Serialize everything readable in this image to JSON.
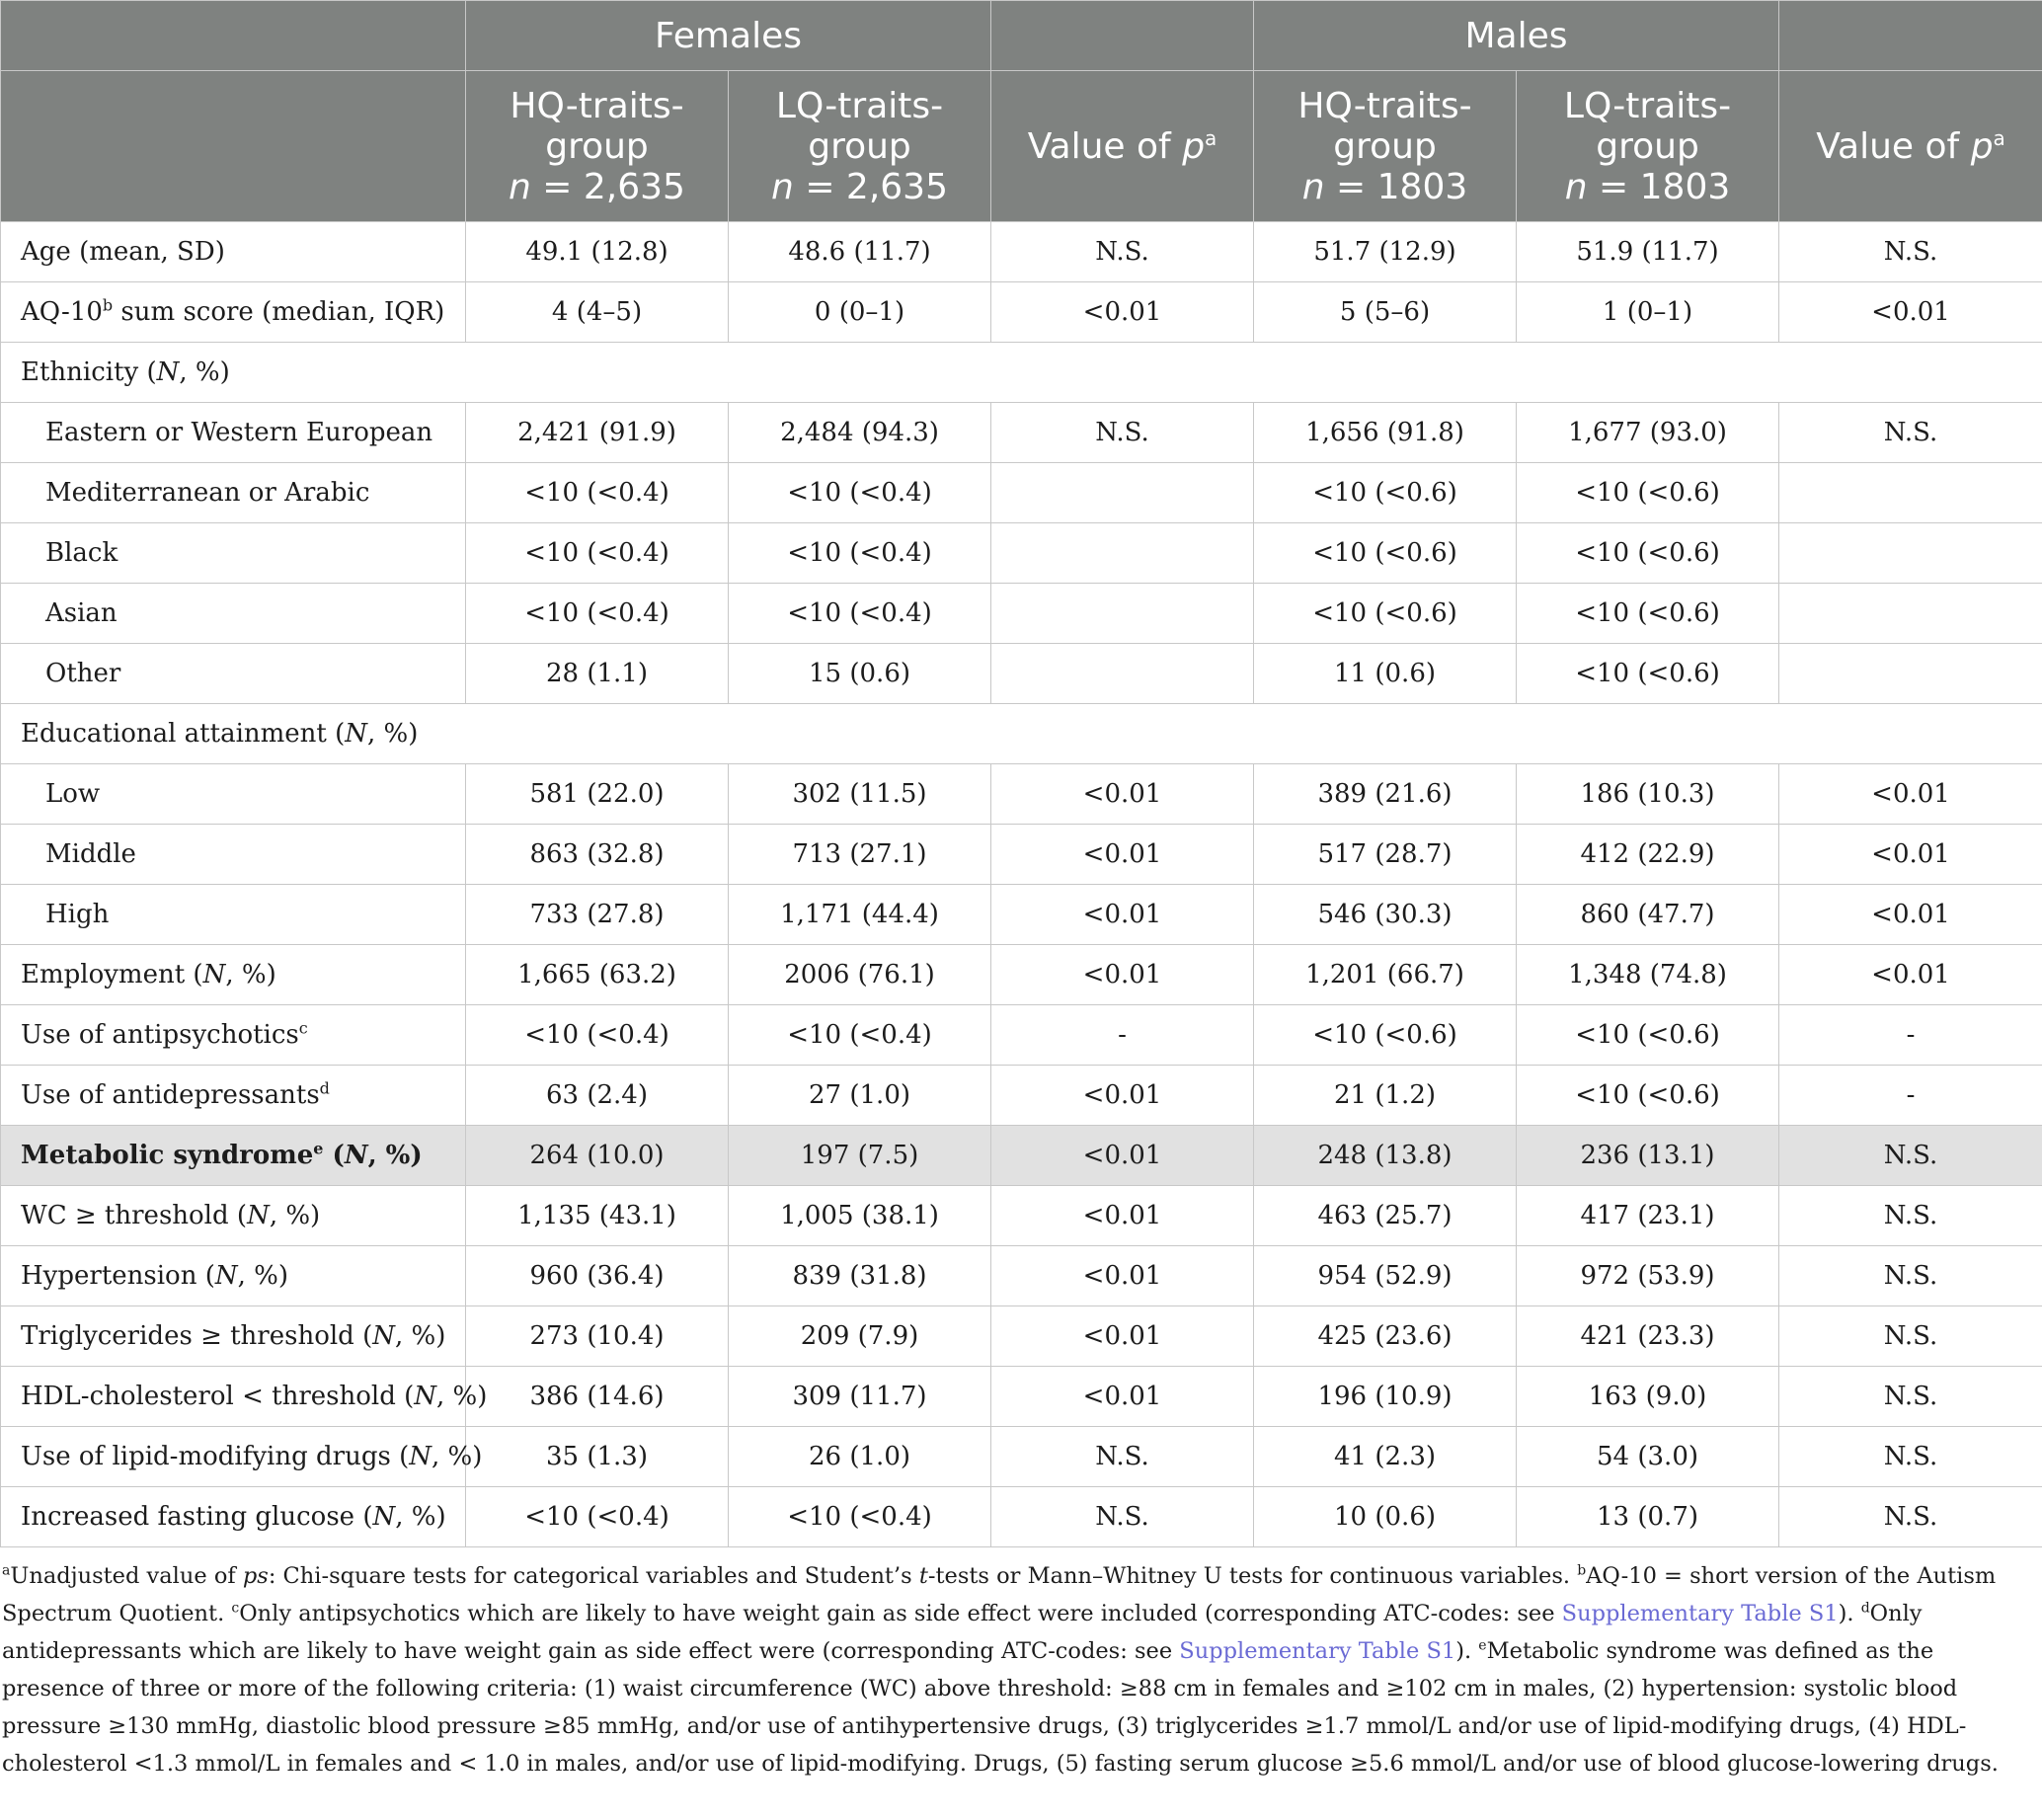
{
  "header": {
    "group_females": "Females",
    "group_males": "Males",
    "col_hq_title": "HQ-traits-group",
    "col_lq_title": "LQ-traits-group",
    "n_prefix": "n",
    "females_n": "= 2,635",
    "males_n": "= 1803",
    "pvalue_label": "Value of",
    "pvalue_symbol": "p",
    "pvalue_sup": "a"
  },
  "rows": [
    {
      "label": "Age (mean, SD)",
      "fhq": "49.1 (12.8)",
      "flq": "48.6 (11.7)",
      "fp": "N.S.",
      "mhq": "51.7 (12.9)",
      "mlq": "51.9 (11.7)",
      "mp": "N.S."
    },
    {
      "label_pre": "AQ-10",
      "sup": "b",
      "label_post": " sum score (median, IQR)",
      "fhq": "4 (4–5)",
      "flq": "0 (0–1)",
      "fp": "<0.01",
      "mhq": "5 (5–6)",
      "mlq": "1 (0–1)",
      "mp": "<0.01"
    },
    {
      "label_pre": "Ethnicity (",
      "label_it": "N",
      "label_post": ", %)"
    },
    {
      "label": "Eastern or Western European",
      "fhq": "2,421 (91.9)",
      "flq": "2,484 (94.3)",
      "fp": "N.S.",
      "mhq": "1,656 (91.8)",
      "mlq": "1,677 (93.0)",
      "mp": "N.S."
    },
    {
      "label": "Mediterranean or Arabic",
      "fhq": "<10 (<0.4)",
      "flq": "<10 (<0.4)",
      "fp": "",
      "mhq": "<10 (<0.6)",
      "mlq": "<10 (<0.6)",
      "mp": ""
    },
    {
      "label": "Black",
      "fhq": "<10 (<0.4)",
      "flq": "<10 (<0.4)",
      "fp": "",
      "mhq": "<10 (<0.6)",
      "mlq": "<10 (<0.6)",
      "mp": ""
    },
    {
      "label": "Asian",
      "fhq": "<10 (<0.4)",
      "flq": "<10 (<0.4)",
      "fp": "",
      "mhq": "<10 (<0.6)",
      "mlq": "<10 (<0.6)",
      "mp": ""
    },
    {
      "label": "Other",
      "fhq": "28 (1.1)",
      "flq": "15 (0.6)",
      "fp": "",
      "mhq": "11 (0.6)",
      "mlq": "<10 (<0.6)",
      "mp": ""
    },
    {
      "label_pre": "Educational attainment (",
      "label_it": "N",
      "label_post": ", %)"
    },
    {
      "label": "Low",
      "fhq": "581 (22.0)",
      "flq": "302 (11.5)",
      "fp": "<0.01",
      "mhq": "389 (21.6)",
      "mlq": "186 (10.3)",
      "mp": "<0.01"
    },
    {
      "label": "Middle",
      "fhq": "863 (32.8)",
      "flq": "713 (27.1)",
      "fp": "<0.01",
      "mhq": "517 (28.7)",
      "mlq": "412 (22.9)",
      "mp": "<0.01"
    },
    {
      "label": "High",
      "fhq": "733 (27.8)",
      "flq": "1,171 (44.4)",
      "fp": "<0.01",
      "mhq": "546 (30.3)",
      "mlq": "860 (47.7)",
      "mp": "<0.01"
    },
    {
      "label_pre": "Employment (",
      "label_it": "N",
      "label_post": ", %)",
      "fhq": "1,665 (63.2)",
      "flq": "2006 (76.1)",
      "fp": "<0.01",
      "mhq": "1,201 (66.7)",
      "mlq": "1,348 (74.8)",
      "mp": "<0.01"
    },
    {
      "label_pre": "Use of antipsychotics",
      "sup": "c",
      "fhq": "<10 (<0.4)",
      "flq": "<10 (<0.4)",
      "fp": "-",
      "mhq": "<10 (<0.6)",
      "mlq": "<10 (<0.6)",
      "mp": "-"
    },
    {
      "label_pre": "Use of antidepressants",
      "sup": "d",
      "fhq": "63 (2.4)",
      "flq": "27 (1.0)",
      "fp": "<0.01",
      "mhq": "21 (1.2)",
      "mlq": "<10 (<0.6)",
      "mp": "-"
    },
    {
      "label_pre": "Metabolic syndrome",
      "sup": "e",
      "label_post": " (",
      "label_it": "N",
      "label_post2": ", %)",
      "fhq": "264 (10.0)",
      "flq": "197 (7.5)",
      "fp": "<0.01",
      "mhq": "248 (13.8)",
      "mlq": "236 (13.1)",
      "mp": "N.S."
    },
    {
      "label_pre": "WC ≥ threshold (",
      "label_it": "N",
      "label_post": ", %)",
      "fhq": "1,135 (43.1)",
      "flq": "1,005 (38.1)",
      "fp": "<0.01",
      "mhq": "463 (25.7)",
      "mlq": "417 (23.1)",
      "mp": "N.S."
    },
    {
      "label_pre": "Hypertension (",
      "label_it": "N",
      "label_post": ", %)",
      "fhq": "960 (36.4)",
      "flq": "839 (31.8)",
      "fp": "<0.01",
      "mhq": "954 (52.9)",
      "mlq": "972 (53.9)",
      "mp": "N.S."
    },
    {
      "label_pre": "Triglycerides ≥ threshold (",
      "label_it": "N",
      "label_post": ", %)",
      "fhq": "273 (10.4)",
      "flq": "209 (7.9)",
      "fp": "<0.01",
      "mhq": "425 (23.6)",
      "mlq": "421 (23.3)",
      "mp": "N.S."
    },
    {
      "label_pre": "HDL-cholesterol < threshold (",
      "label_it": "N",
      "label_post": ", %)",
      "fhq": "386 (14.6)",
      "flq": "309 (11.7)",
      "fp": "<0.01",
      "mhq": "196 (10.9)",
      "mlq": "163 (9.0)",
      "mp": "N.S."
    },
    {
      "label_pre": "Use of lipid-modifying drugs (",
      "label_it": "N",
      "label_post": ", %)",
      "fhq": "35 (1.3)",
      "flq": "26 (1.0)",
      "fp": "N.S.",
      "mhq": "41 (2.3)",
      "mlq": "54 (3.0)",
      "mp": "N.S."
    },
    {
      "label_pre": "Increased fasting glucose (",
      "label_it": "N",
      "label_post": ", %)",
      "fhq": "<10 (<0.4)",
      "flq": "<10 (<0.4)",
      "fp": "N.S.",
      "mhq": "10 (0.6)",
      "mlq": "13 (0.7)",
      "mp": "N.S."
    }
  ],
  "footnotes": {
    "a_sup": "a",
    "a_pre": "Unadjusted value of ",
    "a_it1": "ps",
    "a_mid": ": Chi-square tests for categorical variables and Student’s ",
    "a_it2": "t",
    "a_post": "-tests or Mann–Whitney U tests for continuous variables. ",
    "b_sup": "b",
    "b_text": "AQ-10 = short version of the Autism Spectrum Quotient. ",
    "c_sup": "c",
    "c_text": "Only antipsychotics which are likely to have weight gain as side effect were included (corresponding ATC-codes: see ",
    "c_link": "Supplementary Table S1",
    "c_end": "). ",
    "d_sup": "d",
    "d_text": "Only antidepressants which are likely to have weight gain as side effect were (corresponding ATC-codes: see ",
    "d_link": "Supplementary Table S1",
    "d_end": "). ",
    "e_sup": "e",
    "e_text": "Metabolic syndrome was defined as the presence of three or more of the following criteria: (1) waist circumference (WC) above threshold: ≥88 cm in females and ≥102 cm in males, (2) hypertension: systolic blood pressure ≥130 mmHg, diastolic blood pressure ≥85 mmHg, and/or use of antihypertensive drugs, (3) triglycerides ≥1.7 mmol/L and/or use of lipid-modifying drugs, (4) HDL-cholesterol <1.3 mmol/L in females and < 1.0 in males, and/or use of lipid-modifying. Drugs, (5) fasting serum glucose ≥5.6 mmol/L and/or use of blood glucose-lowering drugs."
  }
}
